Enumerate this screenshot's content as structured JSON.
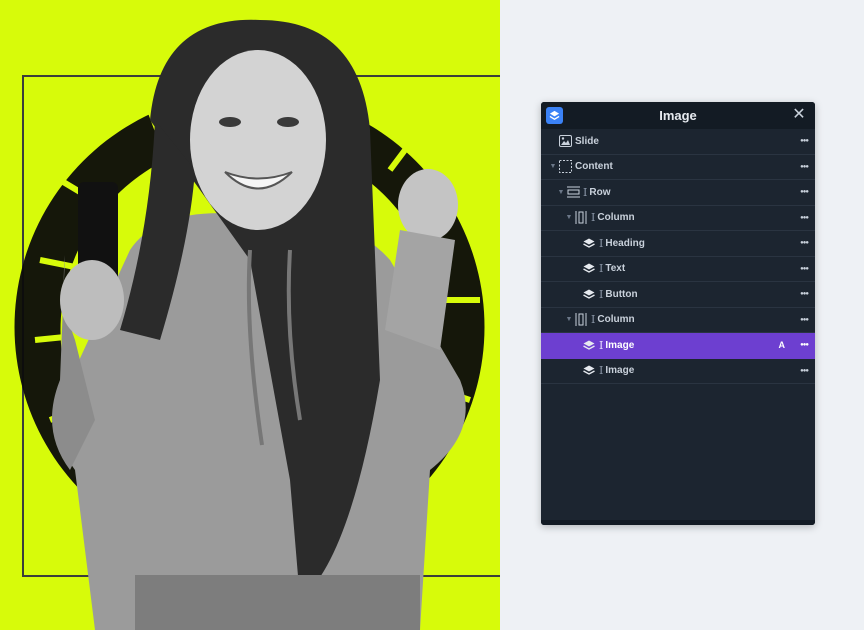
{
  "panel": {
    "title": "Image",
    "close_icon": "close-icon",
    "accent": "#6d3fd0",
    "logo_color": "#3b82f6"
  },
  "canvas": {
    "background": "#d7fb0a"
  },
  "layers": [
    {
      "label": "Slide",
      "icon": "slide-icon",
      "depth": 0,
      "caret": false,
      "cursor": false,
      "active": false,
      "badge": ""
    },
    {
      "label": "Content",
      "icon": "content-icon",
      "depth": 0,
      "caret": true,
      "cursor": false,
      "active": false,
      "badge": ""
    },
    {
      "label": "Row",
      "icon": "row-icon",
      "depth": 1,
      "caret": true,
      "cursor": true,
      "active": false,
      "badge": ""
    },
    {
      "label": "Column",
      "icon": "column-icon",
      "depth": 2,
      "caret": true,
      "cursor": true,
      "active": false,
      "badge": ""
    },
    {
      "label": "Heading",
      "icon": "layers-icon",
      "depth": 3,
      "caret": false,
      "cursor": true,
      "active": false,
      "badge": ""
    },
    {
      "label": "Text",
      "icon": "layers-icon",
      "depth": 3,
      "caret": false,
      "cursor": true,
      "active": false,
      "badge": ""
    },
    {
      "label": "Button",
      "icon": "layers-icon",
      "depth": 3,
      "caret": false,
      "cursor": true,
      "active": false,
      "badge": ""
    },
    {
      "label": "Column",
      "icon": "column-icon",
      "depth": 2,
      "caret": true,
      "cursor": true,
      "active": false,
      "badge": ""
    },
    {
      "label": "Image",
      "icon": "layers-icon",
      "depth": 3,
      "caret": false,
      "cursor": true,
      "active": true,
      "badge": "A"
    },
    {
      "label": "Image",
      "icon": "layers-icon",
      "depth": 3,
      "caret": false,
      "cursor": true,
      "active": false,
      "badge": ""
    }
  ]
}
